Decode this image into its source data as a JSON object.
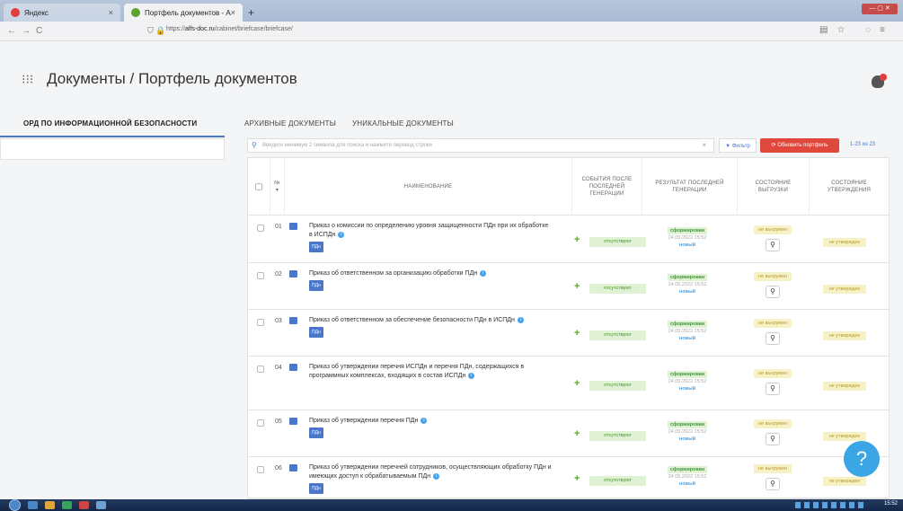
{
  "browser": {
    "tabs": [
      {
        "label": "Яндекс",
        "favicon_color": "#e23d3d",
        "active": false
      },
      {
        "label": "Портфель документов - Альс",
        "favicon_color": "#5aa52f",
        "active": true
      }
    ],
    "url_prefix": "https://",
    "url_domain": "alfs-doc.ru",
    "url_path": "/cabinet/briefcase/briefcase/"
  },
  "header": {
    "grid_icon": "grid-icon",
    "section": "Документы",
    "separator": "/",
    "title": "Портфель документов",
    "bell_icon": "bell-icon"
  },
  "tabs": [
    {
      "label": "ОРД ПО ИНФОРМАЦИОННОЙ БЕЗОПАСНОСТИ",
      "active": true
    },
    {
      "label": "АРХИВНЫЕ ДОКУМЕНТЫ",
      "active": false
    },
    {
      "label": "УНИКАЛЬНЫЕ ДОКУМЕНТЫ",
      "active": false
    }
  ],
  "toolbar": {
    "search_placeholder": "Введите минимум 2 символа для поиска и нажмите перевод строки",
    "clear": "×",
    "filter_label": "▼ Фильтр",
    "refresh_label": "⟳ Обновить портфель",
    "count": "1-23 из 23"
  },
  "table": {
    "headers": {
      "num": "№ ▾",
      "name": "НАИМЕНОВАНИЕ",
      "events": "СОБЫТИЯ ПОСЛЕ ПОСЛЕДНЕЙ ГЕНЕРАЦИИ",
      "result": "РЕЗУЛЬТАТ ПОСЛЕДНЕЙ ГЕНЕРАЦИИ",
      "unload": "СОСТОЯНИЕ ВЫГРУЗКИ",
      "approval": "СОСТОЯНИЕ УТВЕРЖДЕНИЯ"
    },
    "rows": [
      {
        "num": "01",
        "name": "Приказ о комиссии по определению уровня защищенности ПДн при их обработке в ИСПДн",
        "tag": "ПДн",
        "events": "отсутствуют",
        "result_status": "сформирован",
        "result_date": "24.05.2022 15:52",
        "result_note": "новый",
        "unload": "не выгружен",
        "approval": "не утвержден"
      },
      {
        "num": "02",
        "name": "Приказ об ответственном за организацию обработки ПДн",
        "tag": "ПДн",
        "events": "отсутствуют",
        "result_status": "сформирован",
        "result_date": "24.05.2022 15:52",
        "result_note": "новый",
        "unload": "не выгружен",
        "approval": "не утвержден"
      },
      {
        "num": "03",
        "name": "Приказ об ответственном за обеспечение безопасности ПДн в ИСПДн",
        "tag": "ПДн",
        "events": "отсутствуют",
        "result_status": "сформирован",
        "result_date": "24.05.2022 15:52",
        "result_note": "новый",
        "unload": "не выгружен",
        "approval": "не утвержден"
      },
      {
        "num": "04",
        "name": "Приказ об утверждении перечня ИСПДн и перечня ПДн, содержащихся в программных комплексах, входящих в состав ИСПДн",
        "tag": "",
        "events": "отсутствуют",
        "result_status": "сформирован",
        "result_date": "24.05.2022 15:52",
        "result_note": "новый",
        "unload": "не выгружен",
        "approval": "не утвержден"
      },
      {
        "num": "05",
        "name": "Приказ об утверждении перечня ПДн",
        "tag": "ПДн",
        "events": "отсутствуют",
        "result_status": "сформирован",
        "result_date": "24.05.2022 15:52",
        "result_note": "новый",
        "unload": "не выгружен",
        "approval": "не утвержден"
      },
      {
        "num": "06",
        "name": "Приказ об утверждении перечней сотрудников, осуществляющих обработку ПДн и имеющих доступ к обрабатываемым ПДн",
        "tag": "ПДн",
        "events": "отсутствуют",
        "result_status": "сформирован",
        "result_date": "24.05.2022 15:52",
        "result_note": "новый",
        "unload": "не выгружен",
        "approval": "не утвержден"
      }
    ]
  },
  "help_label": "?",
  "taskbar": {
    "clock": "15:52"
  },
  "colors": {
    "accent": "#4a77c8",
    "danger": "#e0483d",
    "success_bg": "#dff2d4",
    "warn_bg": "#f7f2c5"
  }
}
